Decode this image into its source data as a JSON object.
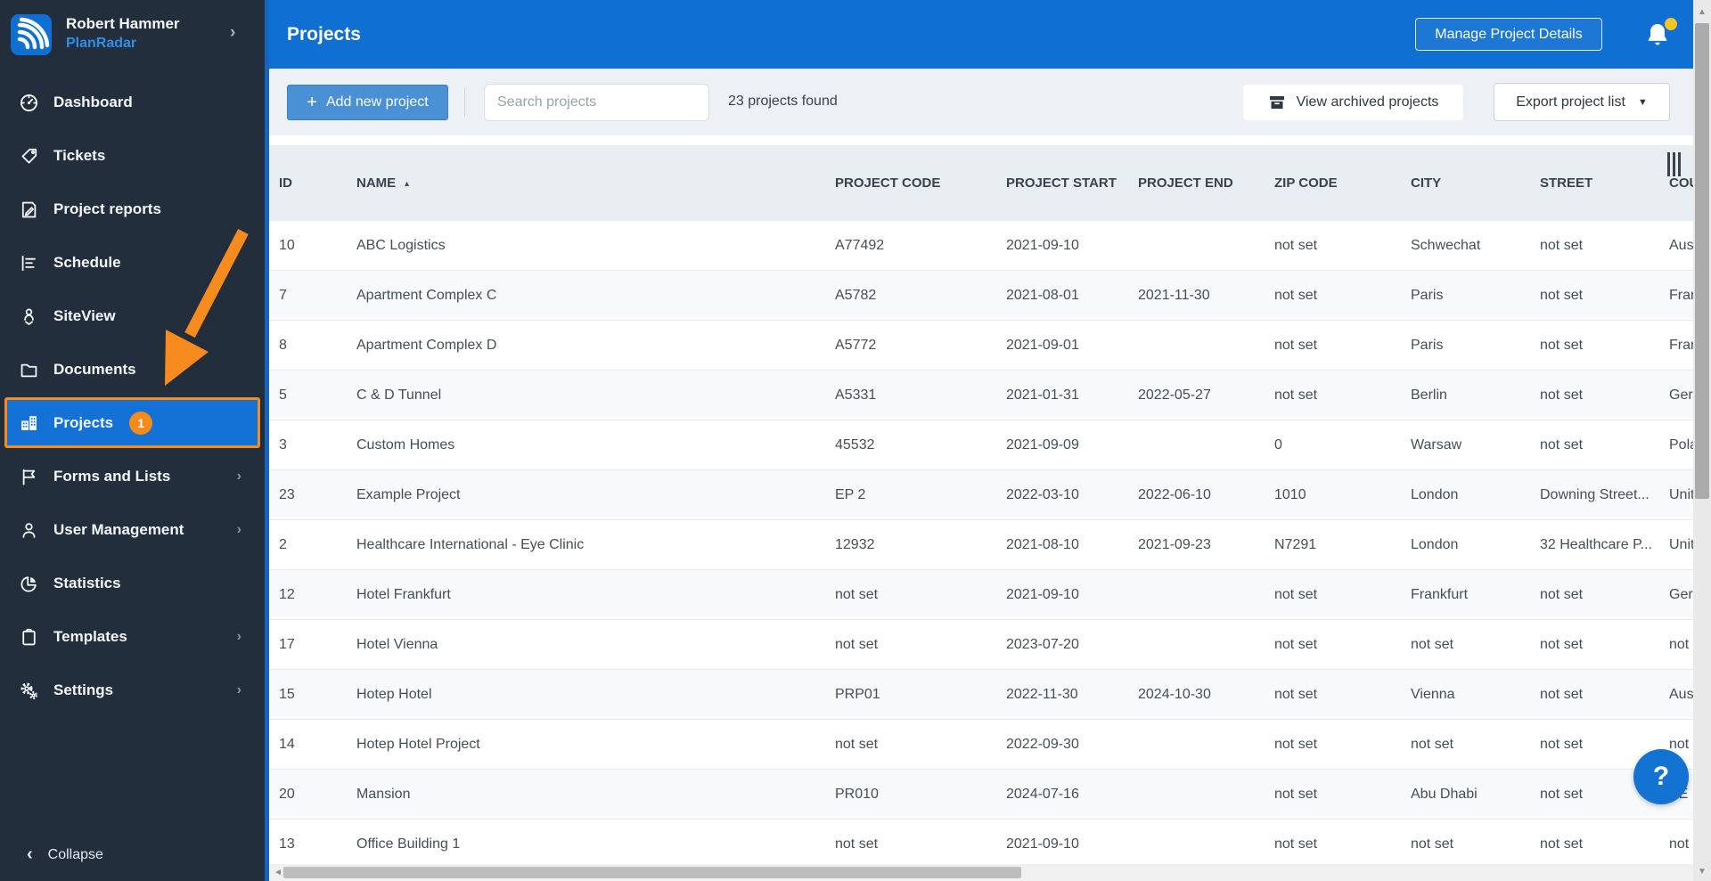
{
  "sidebar": {
    "user": {
      "name": "Robert Hammer",
      "brand": "PlanRadar"
    },
    "items": [
      {
        "label": "Dashboard",
        "icon": "dashboard-icon"
      },
      {
        "label": "Tickets",
        "icon": "tickets-icon"
      },
      {
        "label": "Project reports",
        "icon": "project-reports-icon"
      },
      {
        "label": "Schedule",
        "icon": "schedule-icon"
      },
      {
        "label": "SiteView",
        "icon": "siteview-icon"
      },
      {
        "label": "Documents",
        "icon": "documents-icon"
      },
      {
        "label": "Projects",
        "icon": "projects-icon",
        "active": true,
        "badge": "1"
      },
      {
        "label": "Forms and Lists",
        "icon": "forms-icon",
        "expandable": true
      },
      {
        "label": "User Management",
        "icon": "users-icon",
        "expandable": true
      },
      {
        "label": "Statistics",
        "icon": "statistics-icon"
      },
      {
        "label": "Templates",
        "icon": "templates-icon",
        "expandable": true
      },
      {
        "label": "Settings",
        "icon": "settings-icon",
        "expandable": true
      }
    ],
    "collapse_label": "Collapse"
  },
  "header": {
    "title": "Projects",
    "manage_button": "Manage Project Details"
  },
  "toolbar": {
    "add_button": "Add new project",
    "search_placeholder": "Search projects",
    "search_value": "",
    "results_count": "23 projects found",
    "view_archived": "View archived projects",
    "export_button": "Export project list"
  },
  "table": {
    "columns": [
      "ID",
      "NAME",
      "PROJECT CODE",
      "PROJECT START",
      "PROJECT END",
      "ZIP CODE",
      "CITY",
      "STREET",
      "COUNTRY"
    ],
    "sort_column": "NAME",
    "sort_direction": "asc",
    "rows": [
      {
        "id": "10",
        "name": "ABC Logistics",
        "code": "A77492",
        "start": "2021-09-10",
        "end": "",
        "zip": "not set",
        "city": "Schwechat",
        "street": "not set",
        "country": "Austria"
      },
      {
        "id": "7",
        "name": "Apartment Complex C",
        "code": "A5782",
        "start": "2021-08-01",
        "end": "2021-11-30",
        "zip": "not set",
        "city": "Paris",
        "street": "not set",
        "country": "France"
      },
      {
        "id": "8",
        "name": "Apartment Complex D",
        "code": "A5772",
        "start": "2021-09-01",
        "end": "",
        "zip": "not set",
        "city": "Paris",
        "street": "not set",
        "country": "France"
      },
      {
        "id": "5",
        "name": "C & D Tunnel",
        "code": "A5331",
        "start": "2021-01-31",
        "end": "2022-05-27",
        "zip": "not set",
        "city": "Berlin",
        "street": "not set",
        "country": "Germany"
      },
      {
        "id": "3",
        "name": "Custom Homes",
        "code": "45532",
        "start": "2021-09-09",
        "end": "",
        "zip": "0",
        "city": "Warsaw",
        "street": "not set",
        "country": "Poland"
      },
      {
        "id": "23",
        "name": "Example Project",
        "code": "EP 2",
        "start": "2022-03-10",
        "end": "2022-06-10",
        "zip": "1010",
        "city": "London",
        "street": "Downing Street...",
        "country": "United Kingdom"
      },
      {
        "id": "2",
        "name": "Healthcare International - Eye Clinic",
        "code": "12932",
        "start": "2021-08-10",
        "end": "2021-09-23",
        "zip": "N7291",
        "city": "London",
        "street": "32 Healthcare P...",
        "country": "United Kingdom"
      },
      {
        "id": "12",
        "name": "Hotel Frankfurt",
        "code": "not set",
        "start": "2021-09-10",
        "end": "",
        "zip": "not set",
        "city": "Frankfurt",
        "street": "not set",
        "country": "Germany"
      },
      {
        "id": "17",
        "name": "Hotel Vienna",
        "code": "not set",
        "start": "2023-07-20",
        "end": "",
        "zip": "not set",
        "city": "not set",
        "street": "not set",
        "country": "not set"
      },
      {
        "id": "15",
        "name": "Hotep Hotel",
        "code": "PRP01",
        "start": "2022-11-30",
        "end": "2024-10-30",
        "zip": "not set",
        "city": "Vienna",
        "street": "not set",
        "country": "Austria"
      },
      {
        "id": "14",
        "name": "Hotep Hotel Project",
        "code": "not set",
        "start": "2022-09-30",
        "end": "",
        "zip": "not set",
        "city": "not set",
        "street": "not set",
        "country": "not set"
      },
      {
        "id": "20",
        "name": "Mansion",
        "code": "PR010",
        "start": "2024-07-16",
        "end": "",
        "zip": "not set",
        "city": "Abu Dhabi",
        "street": "not set",
        "country": "AE"
      },
      {
        "id": "13",
        "name": "Office Building 1",
        "code": "not set",
        "start": "2021-09-10",
        "end": "",
        "zip": "not set",
        "city": "not set",
        "street": "not set",
        "country": "not set"
      }
    ]
  },
  "ui": {
    "help_label": "?",
    "sort_indicator": "▲",
    "notification_badge": true
  },
  "colors": {
    "sidebar_bg": "#232e3c",
    "header_blue": "#0f6fd2",
    "selected_item_blue": "#1471d6",
    "highlight_orange": "#f78b1e",
    "toolbar_bg": "#edf1f5",
    "table_header_bg": "#e9eef3",
    "row_alt_bg": "#f7f9fb",
    "notification_dot": "#f2c522"
  }
}
